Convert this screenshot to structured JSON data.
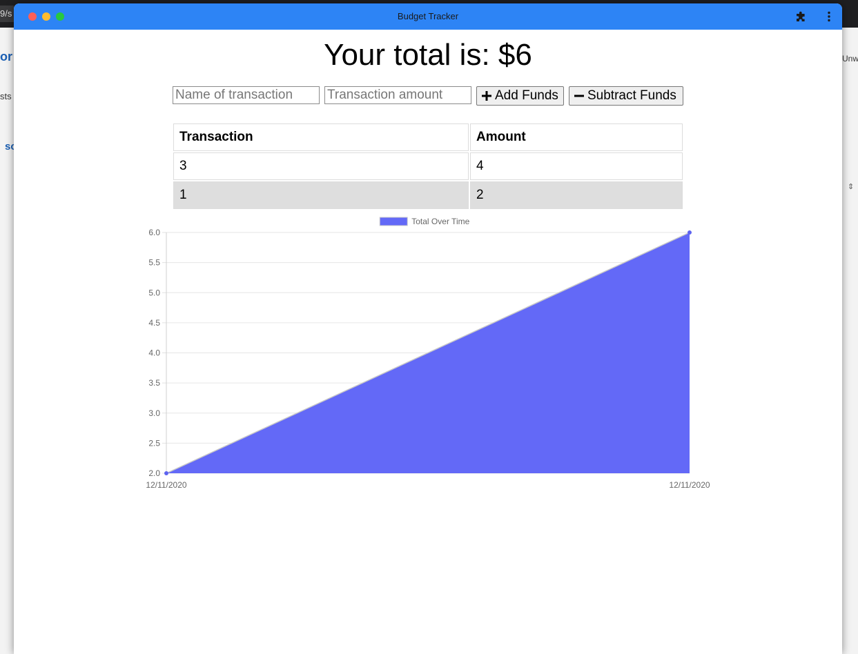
{
  "window": {
    "title": "Budget Tracker"
  },
  "background": {
    "url_fragment": "9/s",
    "left_fragments": [
      "or",
      "sts",
      "sc"
    ],
    "right_fragments": [
      "Unw"
    ]
  },
  "header": {
    "total_text": "Your total is: $6"
  },
  "form": {
    "name_placeholder": "Name of transaction",
    "amount_placeholder": "Transaction amount",
    "add_label": "Add Funds",
    "subtract_label": "Subtract Funds"
  },
  "table": {
    "headers": [
      "Transaction",
      "Amount"
    ],
    "rows": [
      [
        "3",
        "4"
      ],
      [
        "1",
        "2"
      ]
    ]
  },
  "colors": {
    "titlebar": "#2d84f5",
    "series_fill": "#6369f7",
    "series_point": "#5d63f0"
  },
  "chart_data": {
    "type": "area",
    "x": [
      "12/11/2020",
      "12/11/2020"
    ],
    "series": [
      {
        "name": "Total Over Time",
        "values": [
          2,
          6
        ]
      }
    ],
    "y_ticks": [
      2.0,
      2.5,
      3.0,
      3.5,
      4.0,
      4.5,
      5.0,
      5.5,
      6.0
    ],
    "ylim": [
      2,
      6
    ],
    "grid": true,
    "legend": "top-center",
    "title": "",
    "xlabel": "",
    "ylabel": ""
  }
}
